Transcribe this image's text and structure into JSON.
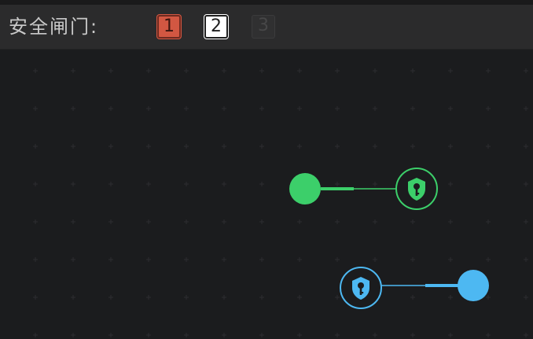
{
  "toolbar": {
    "title": "安全闸门:",
    "gates": [
      {
        "label": "1",
        "state": "active",
        "color": "#d25742"
      },
      {
        "label": "2",
        "state": "selected",
        "color": "#ffffff"
      },
      {
        "label": "3",
        "state": "disabled",
        "color": "#303031"
      }
    ]
  },
  "canvas": {
    "background": "#1b1c1e",
    "grid_mark": "+",
    "links": [
      {
        "name": "green-gate-link",
        "color": "#3ccf6a",
        "icon": "shield-key-icon"
      },
      {
        "name": "blue-gate-link",
        "color": "#4db8f2",
        "icon": "shield-key-icon"
      }
    ]
  }
}
